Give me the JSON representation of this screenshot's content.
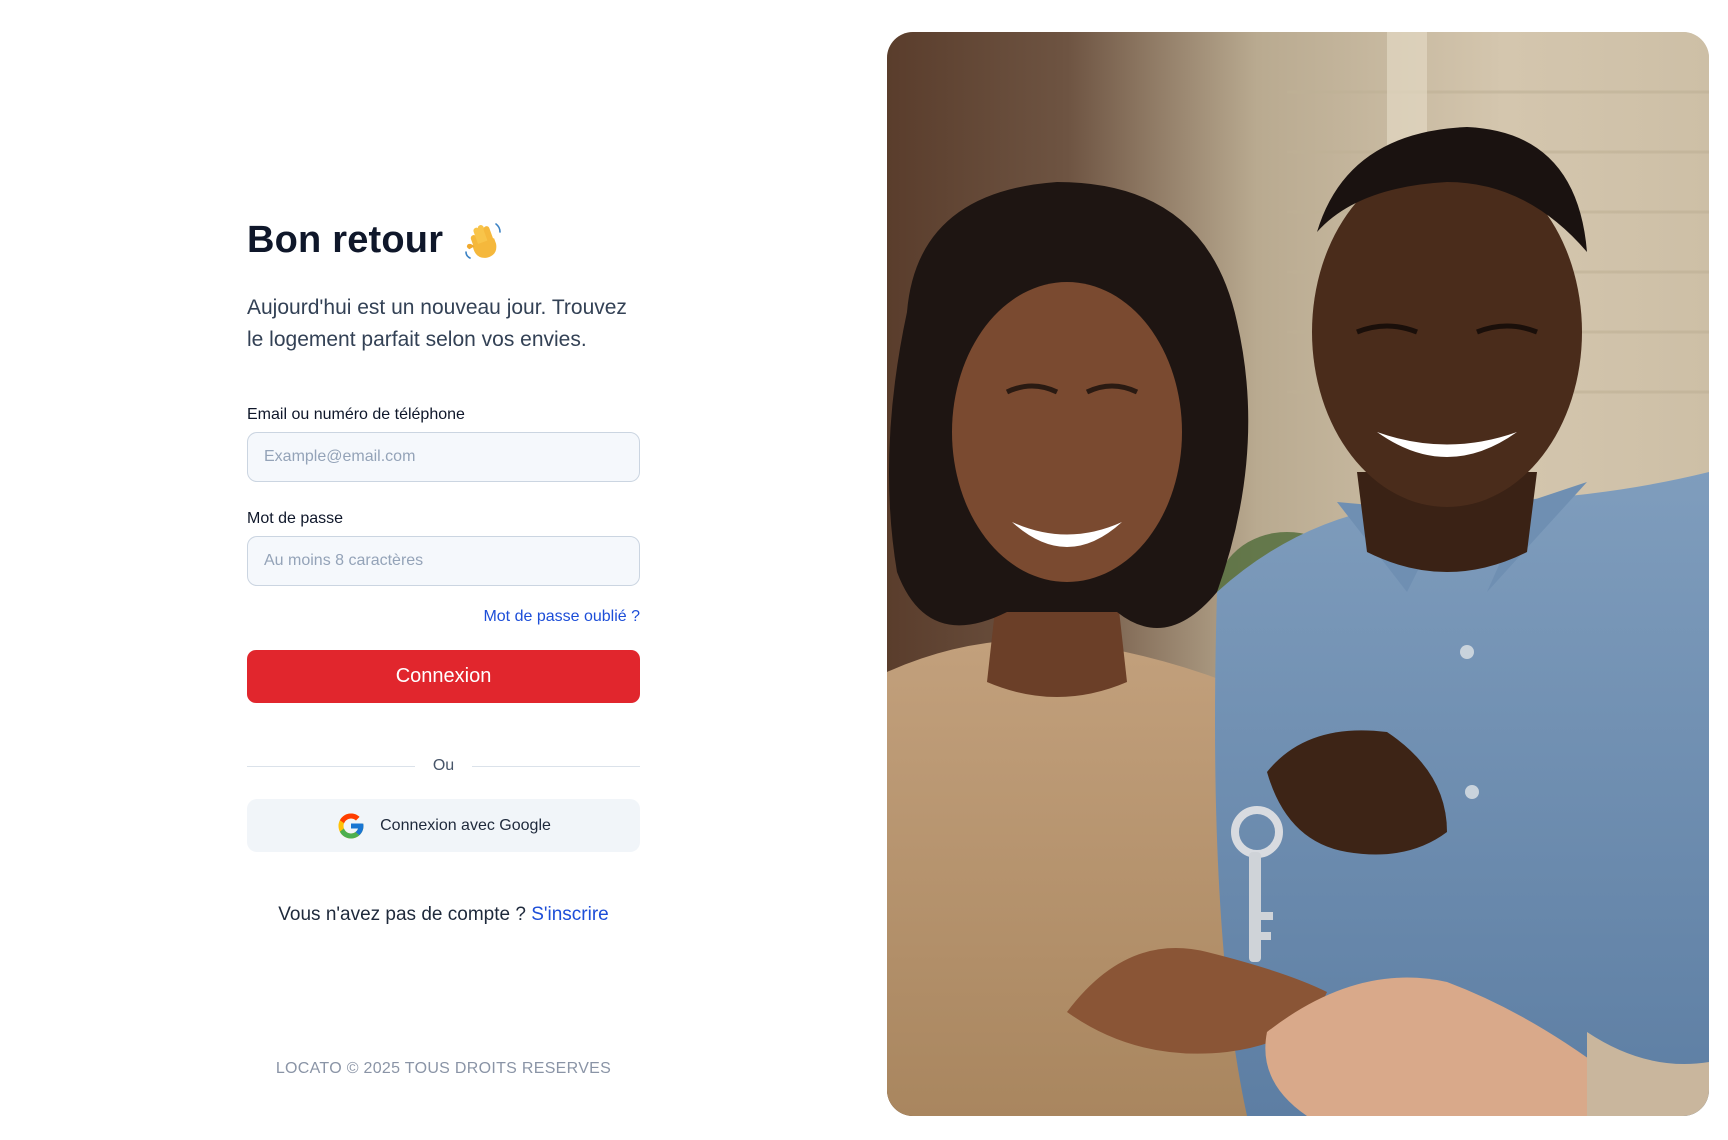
{
  "login": {
    "title": "Bon retour",
    "title_icon": "waving-hand-icon",
    "subtitle": "Aujourd'hui est un nouveau jour. Trouvez le logement parfait selon vos envies.",
    "email_label": "Email ou numéro de téléphone",
    "email_placeholder": "Example@email.com",
    "email_value": "",
    "password_label": "Mot de passe",
    "password_placeholder": "Au moins 8 caractères",
    "password_value": "",
    "forgot_password": "Mot de passe oublié ?",
    "submit_label": "Connexion",
    "divider_label": "Ou",
    "google_label": "Connexion avec Google",
    "google_icon": "google-icon",
    "signup_prompt": "Vous n'avez pas de compte ?",
    "signup_link": "S'inscrire"
  },
  "footer": {
    "copyright": "LOCATO © 2025 TOUS DROITS RESERVES"
  },
  "colors": {
    "primary": "#e1262d",
    "link": "#1d4ed8",
    "input_bg": "#f5f8fc",
    "google_bg": "#f1f5f9"
  }
}
